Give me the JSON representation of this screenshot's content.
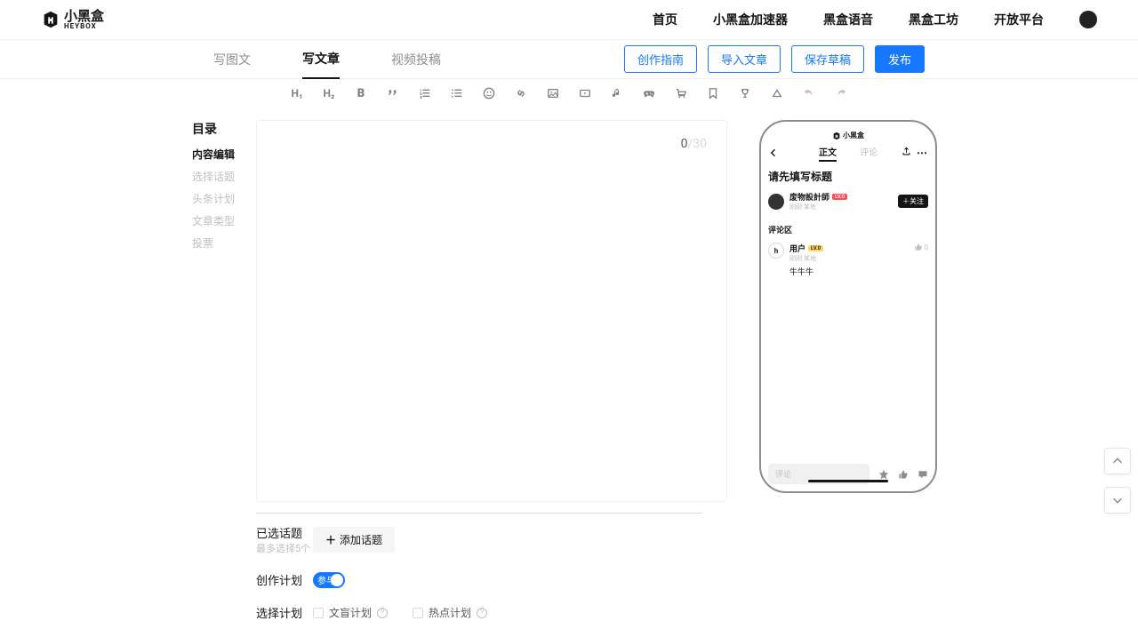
{
  "brand": {
    "name": "小黑盒",
    "sub": "HEYBOX"
  },
  "nav": {
    "home": "首页",
    "accelerator": "小黑盒加速器",
    "voice": "黑盒语音",
    "workshop": "黑盒工坊",
    "open": "开放平台"
  },
  "content_tabs": {
    "image": "写图文",
    "article": "写文章",
    "video": "视频投稿"
  },
  "actions": {
    "guide": "创作指南",
    "import": "导入文章",
    "draft": "保存草稿",
    "publish": "发布"
  },
  "toc": {
    "title": "目录",
    "items": {
      "edit": "内容编辑",
      "topic": "选择话题",
      "headline": "头条计划",
      "type": "文章类型",
      "vote": "投票"
    }
  },
  "counter": {
    "current": "0",
    "max": "/30"
  },
  "settings": {
    "selected_topic": {
      "label": "已选话题",
      "hint": "最多选择5个",
      "add": "添加话题"
    },
    "plan": {
      "label": "创作计划",
      "join": "参与"
    },
    "select_plan": {
      "label": "选择计划",
      "opt1": "文盲计划",
      "opt2": "热点计划"
    }
  },
  "preview": {
    "brand": "小黑盒",
    "tabs": {
      "body": "正文",
      "comments": "评论"
    },
    "title_placeholder": "请先填写标题",
    "author": {
      "name": "废物設計師",
      "meta": "刚刚·某地",
      "follow": "＋关注"
    },
    "comments": {
      "section": "评论区",
      "user": {
        "name": "用户",
        "meta": "刚刚·某地",
        "text": "牛牛牛",
        "like": "0"
      }
    },
    "input_placeholder": "评论"
  }
}
